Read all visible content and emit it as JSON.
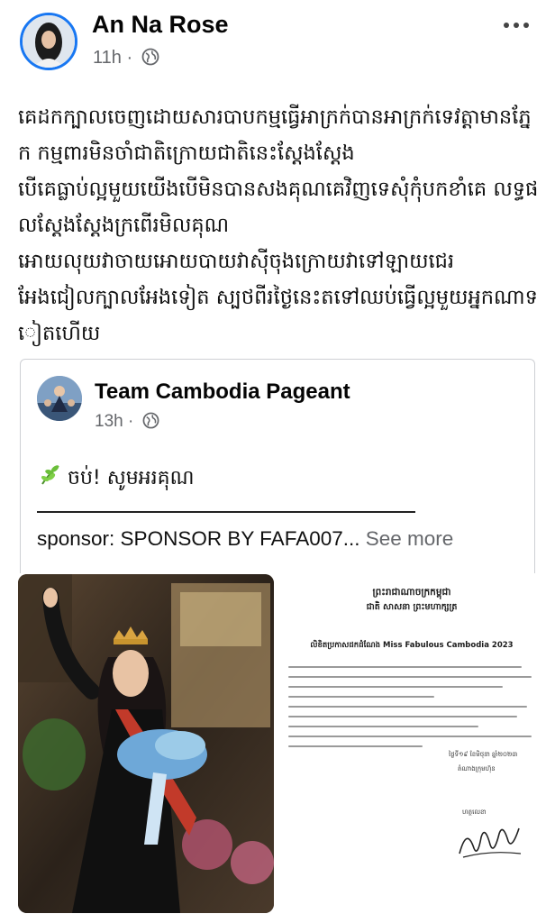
{
  "post": {
    "author": "An Na Rose",
    "time": "11h",
    "text": "គេដកក្បាលចេញដោយសារបាបកម្មធ្វើអាក្រក់បានអាក្រក់ទេវត្តាមានភ្នែក កម្មពារមិនចាំជាតិក្រោយជាតិនេះស្តែងស្តែង\nបើគេធ្លាប់ល្អមួយយើងបើមិនបានសងគុណគេវិញទេសុំកុំបកខាំគេ លទ្ធផលស្តែងស្តែងក្រពើរមិលគុណ\nអោយលុយវាចាយអោយបាយវាស៊ីចុងក្រោយវាទៅឡាយជេរ\nអែងជៀលក្បាលអែងទៀត ស្បថពីរថ្ងៃនេះតទៅឈប់ធ្វើល្អមួយអ្នកណាទៀតហើយ",
    "icons": {
      "privacy": "globe-icon",
      "menu": "more-options-icon"
    }
  },
  "shared_post": {
    "page_name": "Team Cambodia Pageant",
    "time": "13h",
    "line1": "ចប់! សូមអរគុណ",
    "line3": "sponsor: SPONSOR BY FAFA007...",
    "see_more": "See more"
  },
  "document": {
    "title1": "ព្រះរាជាណាចក្រកម្ពុជា",
    "title2": "ជាតិ សាសនា ព្រះមហាក្សត្រ",
    "heading": "លិខិតប្រកាសដកដំណែង Miss Fabulous Cambodia 2023",
    "date": "ថ្ងៃទី១៩ ខែមិថុនា ឆ្នាំ២០២៣",
    "signer": "តំណាងក្រុមហ៊ុន",
    "sig_label": "ហត្ថលេខា"
  },
  "colors": {
    "brand": "#1877f2",
    "meta": "#65676b",
    "text": "#050505"
  }
}
